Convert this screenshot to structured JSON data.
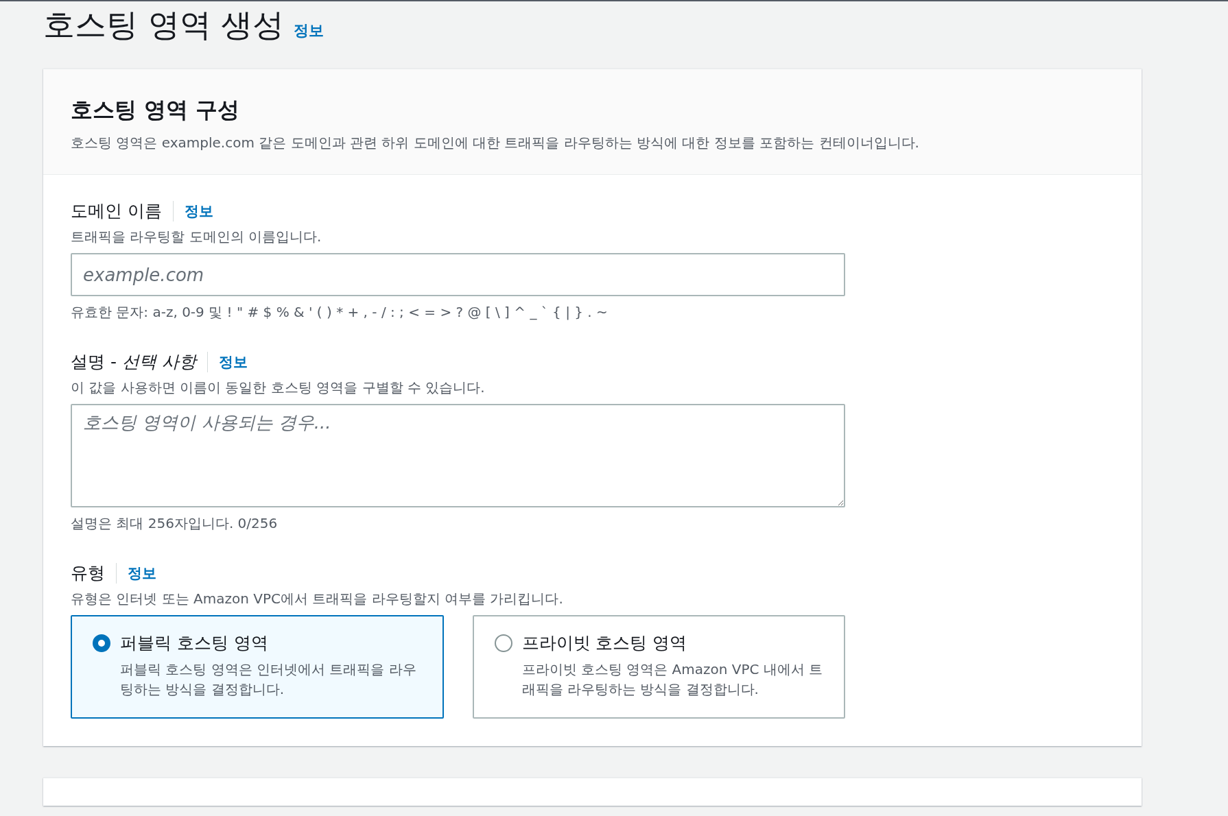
{
  "page": {
    "title": "호스팅 영역 생성",
    "info_link": "정보"
  },
  "card": {
    "title": "호스팅 영역 구성",
    "description": "호스팅 영역은 example.com 같은 도메인과 관련 하위 도메인에 대한 트래픽을 라우팅하는 방식에 대한 정보를 포함하는 컨테이너입니다.",
    "fields": [
      {
        "kind": "input",
        "label": "도메인 이름",
        "info_link": "정보",
        "description": "트래픽을 라우팅할 도메인의 이름입니다.",
        "placeholder": "example.com",
        "constraint": "유효한 문자: a-z, 0-9 및 ! \" # $ % & ' ( ) * + , - / : ; < = > ? @ [ \\ ] ^ _ ` { | } . ~"
      },
      {
        "kind": "textarea",
        "label": "설명 - *선택 사항*",
        "info_link": "정보",
        "description": "이 값을 사용하면 이름이 동일한 호스팅 영역을 구별할 수 있습니다.",
        "placeholder": "호스팅 영역이 사용되는 경우...",
        "constraint": "설명은 최대 256자입니다. 0/256"
      },
      {
        "kind": "radio",
        "label": "유형",
        "info_link": "정보",
        "description": "유형은 인터넷 또는 Amazon VPC에서 트래픽을 라우팅할지 여부를 가리킵니다.",
        "options": [
          {
            "label": "퍼블릭 호스팅 영역",
            "description": "퍼블릭 호스팅 영역은 인터넷에서 트래픽을 라우팅하는 방식을 결정합니다.",
            "selected": true
          },
          {
            "label": "프라이빗 호스팅 영역",
            "description": "프라이빗 호스팅 영역은 Amazon VPC 내에서 트래픽을 라우팅하는 방식을 결정합니다.",
            "selected": false
          }
        ]
      }
    ]
  }
}
